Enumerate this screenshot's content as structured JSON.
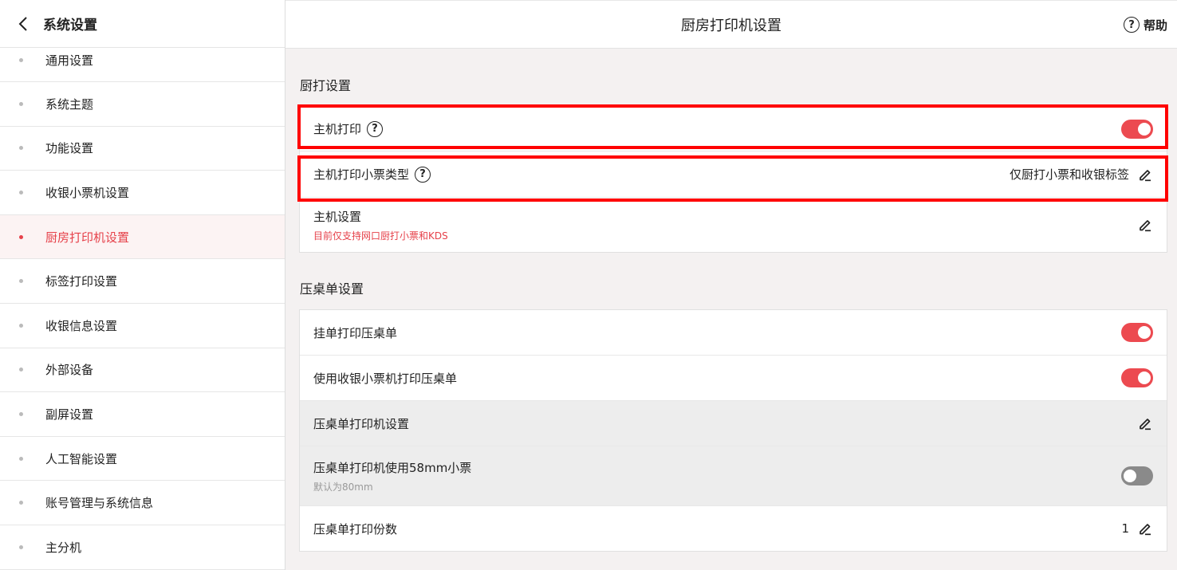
{
  "sidebar": {
    "title": "系统设置",
    "items": [
      {
        "label": "通用设置",
        "active": false
      },
      {
        "label": "系统主题",
        "active": false
      },
      {
        "label": "功能设置",
        "active": false
      },
      {
        "label": "收银小票机设置",
        "active": false
      },
      {
        "label": "厨房打印机设置",
        "active": true
      },
      {
        "label": "标签打印设置",
        "active": false
      },
      {
        "label": "收银信息设置",
        "active": false
      },
      {
        "label": "外部设备",
        "active": false
      },
      {
        "label": "副屏设置",
        "active": false
      },
      {
        "label": "人工智能设置",
        "active": false
      },
      {
        "label": "账号管理与系统信息",
        "active": false
      },
      {
        "label": "主分机",
        "active": false
      }
    ]
  },
  "header": {
    "title": "厨房打印机设置",
    "help_label": "帮助"
  },
  "kitchen_section": {
    "title": "厨打设置",
    "host_print": {
      "label": "主机打印",
      "enabled": true
    },
    "ticket_type": {
      "label": "主机打印小票类型",
      "value": "仅厨打小票和收银标签"
    },
    "host_settings": {
      "label": "主机设置",
      "note": "目前仅支持网口厨打小票和KDS"
    }
  },
  "table_section": {
    "title": "压桌单设置",
    "hang_print": {
      "label": "挂单打印压桌单",
      "enabled": true
    },
    "use_cashier_printer": {
      "label": "使用收银小票机打印压桌单",
      "enabled": true
    },
    "printer_settings": {
      "label": "压桌单打印机设置"
    },
    "use_58mm": {
      "label": "压桌单打印机使用58mm小票",
      "note": "默认为80mm",
      "enabled": false
    },
    "copies": {
      "label": "压桌单打印份数",
      "value": "1"
    }
  },
  "colors": {
    "accent": "#e6414a",
    "toggle_on": "#ec4a50",
    "highlight": "#ff0000"
  }
}
